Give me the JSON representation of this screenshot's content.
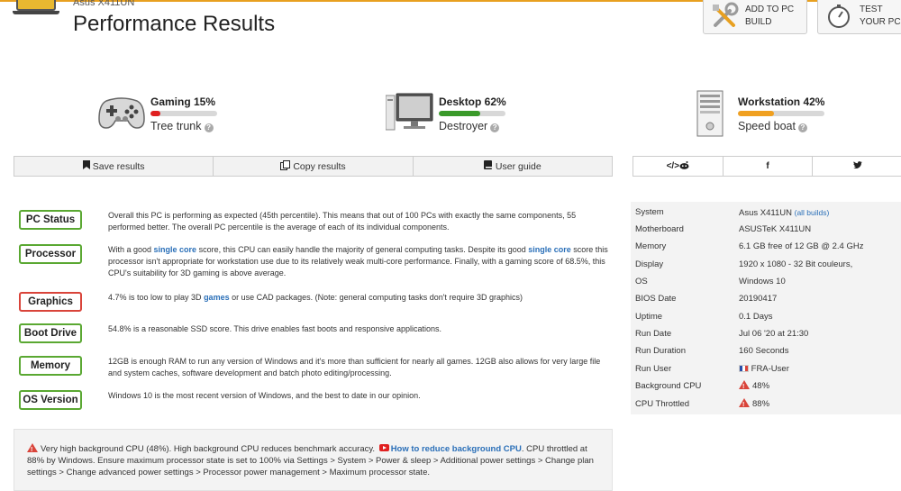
{
  "header": {
    "subtitle": "Asus X411UN",
    "title": "Performance Results",
    "add_to_build": "ADD TO PC\nBUILD",
    "test_pc": "TEST\nYOUR PC"
  },
  "scores": [
    {
      "name": "Gaming 15%",
      "value": 15,
      "verdict": "Tree trunk",
      "color": "#e02020",
      "icon": "gamepad-icon"
    },
    {
      "name": "Desktop 62%",
      "value": 62,
      "verdict": "Destroyer",
      "color": "#3a9a2a",
      "icon": "desktop-icon"
    },
    {
      "name": "Workstation 42%",
      "value": 42,
      "verdict": "Speed boat",
      "color": "#f0a020",
      "icon": "server-tower-icon"
    }
  ],
  "actions": {
    "save": "Save results",
    "copy": "Copy results",
    "guide": "User guide"
  },
  "share": {
    "embed": "</> ",
    "reddit": "reddit-icon",
    "facebook": "f",
    "twitter": "twitter-icon"
  },
  "status": [
    {
      "label": "PC Status",
      "ok": true,
      "parts": [
        {
          "t": "Overall this PC is performing as expected (45th percentile). This means that out of 100 PCs with exactly the same components, 55 performed better. The overall PC percentile is the average of each of its individual components."
        }
      ]
    },
    {
      "label": "Processor",
      "ok": true,
      "parts": [
        {
          "t": "With a good "
        },
        {
          "t": "single core",
          "link": true
        },
        {
          "t": " score, this CPU can easily handle the majority of general computing tasks. Despite its good "
        },
        {
          "t": "single core",
          "link": true
        },
        {
          "t": " score this processor isn't appropriate for workstation use due to its relatively weak multi-core performance. Finally, with a gaming score of 68.5%, this CPU's suitability for 3D gaming is above average."
        }
      ]
    },
    {
      "label": "Graphics",
      "ok": false,
      "parts": [
        {
          "t": "4.7% is too low to play 3D "
        },
        {
          "t": "games",
          "link": true
        },
        {
          "t": " or use CAD packages. (Note: general computing tasks don't require 3D graphics)"
        }
      ]
    },
    {
      "label": "Boot Drive",
      "ok": true,
      "parts": [
        {
          "t": "54.8% is a reasonable SSD score. This drive enables fast boots and responsive applications."
        }
      ]
    },
    {
      "label": "Memory",
      "ok": true,
      "parts": [
        {
          "t": "12GB is enough RAM to run any version of Windows and it's more than sufficient for nearly all games. 12GB also allows for very large file and system caches, software development and batch photo editing/processing."
        }
      ]
    },
    {
      "label": "OS Version",
      "ok": true,
      "parts": [
        {
          "t": "Windows 10 is the most recent version of Windows, and the best to date in our opinion."
        }
      ]
    }
  ],
  "system": [
    {
      "k": "System",
      "v": "Asus X411UN",
      "extra": "(all builds)"
    },
    {
      "k": "Motherboard",
      "v": "ASUSTeK X411UN"
    },
    {
      "k": "Memory",
      "v": "6.1 GB free of 12 GB @ 2.4 GHz"
    },
    {
      "k": "Display",
      "v": "1920 x 1080 - 32 Bit couleurs,"
    },
    {
      "k": "OS",
      "v": "Windows 10"
    },
    {
      "k": "BIOS Date",
      "v": "20190417"
    },
    {
      "k": "Uptime",
      "v": "0.1 Days"
    },
    {
      "k": "Run Date",
      "v": "Jul 06 '20 at 21:30"
    },
    {
      "k": "Run Duration",
      "v": "160 Seconds"
    },
    {
      "k": "Run User",
      "v": "FRA-User",
      "flag": true
    },
    {
      "k": "Background CPU",
      "v": "48%",
      "warn": true
    },
    {
      "k": "CPU Throttled",
      "v": "88%",
      "warn": true
    }
  ],
  "warning": {
    "text1": "Very high background CPU (48%). High background CPU reduces benchmark accuracy.",
    "link": "How to reduce background CPU",
    "text2": ". CPU throttled at 88% by Windows. Ensure maximum processor state is set to 100% via Settings > System > Power & sleep > Additional power settings > Change plan settings > Change advanced power settings > Processor power management > Maximum processor state."
  }
}
